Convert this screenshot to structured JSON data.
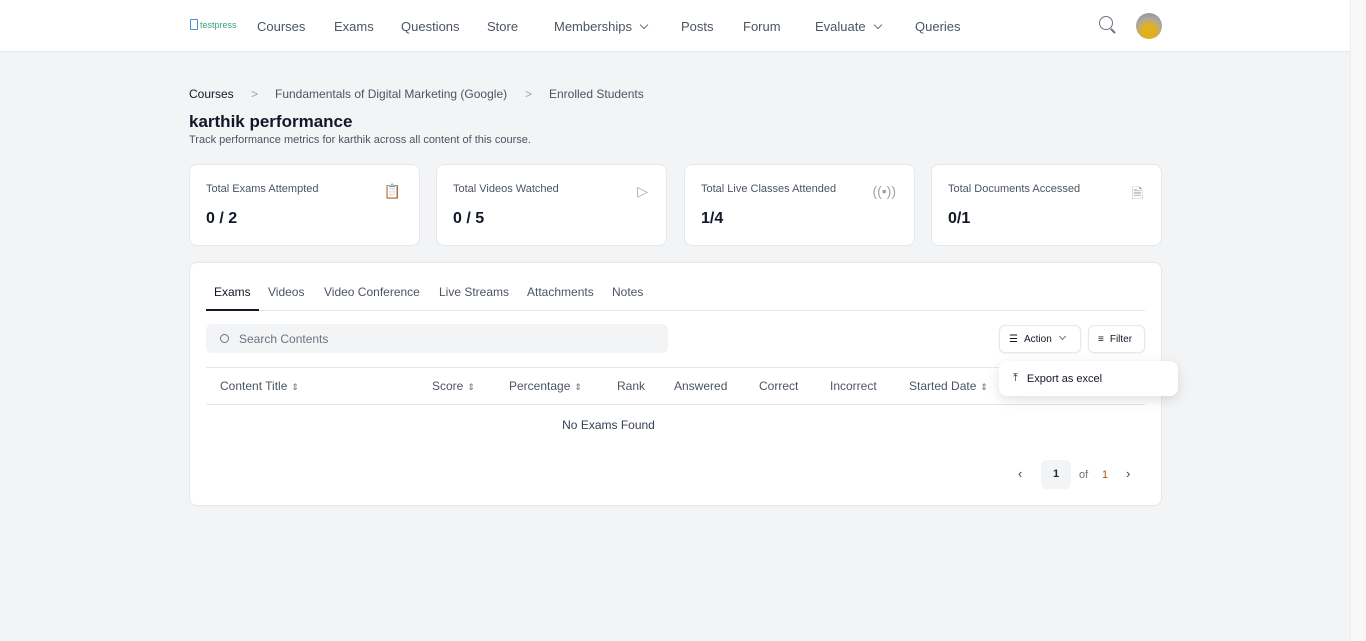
{
  "nav": {
    "logo": "testpress",
    "items": [
      "Courses",
      "Exams",
      "Questions",
      "Store",
      "Memberships",
      "Posts",
      "Forum",
      "Evaluate",
      "Queries"
    ]
  },
  "breadcrumb": [
    "Courses",
    "Fundamentals of Digital Marketing (Google)",
    "Enrolled Students"
  ],
  "page": {
    "title": "karthik performance",
    "subtitle": "Track performance metrics for karthik across all content of this course."
  },
  "cards": [
    {
      "label": "Total Exams Attempted",
      "value": "0 / 2",
      "icon": "clipboard-icon"
    },
    {
      "label": "Total Videos Watched",
      "value": "0 / 5",
      "icon": "video-icon"
    },
    {
      "label": "Total Live Classes Attended",
      "value": "1/4",
      "icon": "broadcast-icon"
    },
    {
      "label": "Total Documents Accessed",
      "value": "0/1",
      "icon": "document-icon"
    }
  ],
  "tabs": [
    "Exams",
    "Videos",
    "Video Conference",
    "Live Streams",
    "Attachments",
    "Notes"
  ],
  "search": {
    "placeholder": "Search Contents"
  },
  "buttons": {
    "action": "Action",
    "filter": "Filter"
  },
  "menu": {
    "export": "Export as excel"
  },
  "columns": [
    "Content Title",
    "Score",
    "Percentage",
    "Rank",
    "Answered",
    "Correct",
    "Incorrect",
    "Started Date"
  ],
  "empty": "No Exams Found",
  "pagination": {
    "current": "1",
    "of": "of",
    "total": "1"
  }
}
